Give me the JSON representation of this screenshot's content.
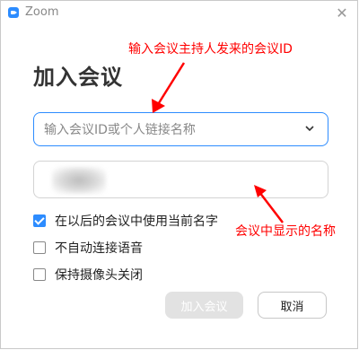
{
  "window": {
    "title": "Zoom"
  },
  "heading": "加入会议",
  "meeting_input": {
    "placeholder": "输入会议ID或个人链接名称"
  },
  "options": [
    {
      "label": "在以后的会议中使用当前名字",
      "checked": true
    },
    {
      "label": "不自动连接语音",
      "checked": false
    },
    {
      "label": "保持摄像头关闭",
      "checked": false
    }
  ],
  "buttons": {
    "join": "加入会议",
    "cancel": "取消"
  },
  "annotations": {
    "top": "输入会议主持人发来的会议ID",
    "bottom": "会议中显示的名称"
  },
  "colors": {
    "accent": "#2d8cff",
    "annotation": "#ff0000"
  }
}
